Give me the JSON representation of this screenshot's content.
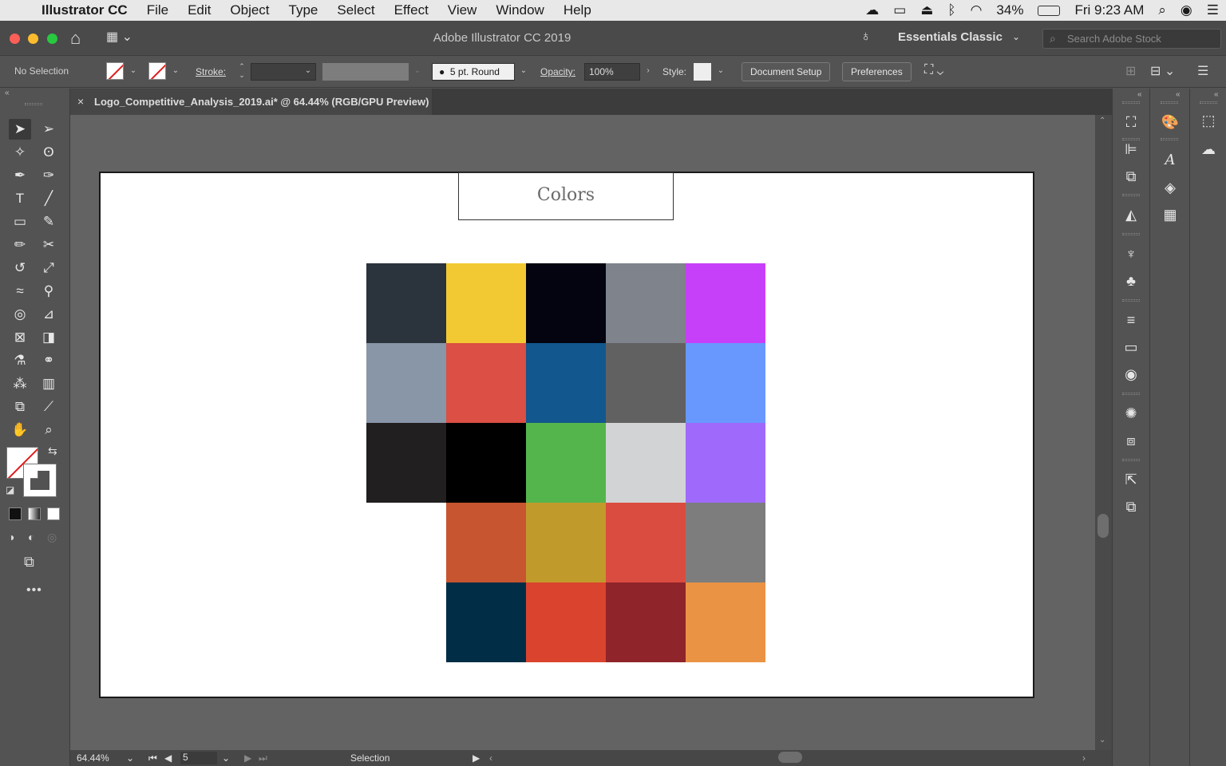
{
  "menubar": {
    "app_name": "Illustrator CC",
    "items": [
      "File",
      "Edit",
      "Object",
      "Type",
      "Select",
      "Effect",
      "View",
      "Window",
      "Help"
    ],
    "battery": "34%",
    "clock": "Fri 9:23 AM"
  },
  "titlebar": {
    "title": "Adobe Illustrator CC 2019",
    "workspace": "Essentials Classic",
    "stock_placeholder": "Search Adobe Stock"
  },
  "controlbar": {
    "selection": "No Selection",
    "stroke_label": "Stroke:",
    "brush": "5 pt. Round",
    "opacity_label": "Opacity:",
    "opacity_value": "100%",
    "style_label": "Style:",
    "document_setup": "Document Setup",
    "preferences": "Preferences"
  },
  "document_tab": {
    "close": "×",
    "title": "Logo_Competitive_Analysis_2019.ai* @ 64.44% (RGB/GPU Preview)"
  },
  "artboard": {
    "heading": "Colors",
    "swatches": [
      [
        "#2b333c",
        "#f2c932",
        "#03040f",
        "#7f838c",
        "#c740f9"
      ],
      [
        "#8896a8",
        "#db4f44",
        "#12578e",
        "#616161",
        "#6898fe"
      ],
      [
        "#221f20",
        "#000000",
        "#54b54c",
        "#d2d3d4",
        "#9f6afb"
      ],
      [
        null,
        "#c7552f",
        "#c19a2c",
        "#db4c40",
        "#7d7d7d"
      ],
      [
        null,
        "#022d47",
        "#da432d",
        "#8f242a",
        "#eb9345"
      ]
    ]
  },
  "statusbar": {
    "zoom": "64.44%",
    "artboard_number": "5",
    "tool": "Selection"
  },
  "icons": {
    "tools": [
      "selection-tool-icon",
      "direct-selection-tool-icon",
      "magic-wand-tool-icon",
      "lasso-tool-icon",
      "pen-tool-icon",
      "curvature-tool-icon",
      "type-tool-icon",
      "line-tool-icon",
      "rectangle-tool-icon",
      "paintbrush-tool-icon",
      "pencil-tool-icon",
      "scissors-tool-icon",
      "rotate-tool-icon",
      "scale-tool-icon",
      "warp-tool-icon",
      "pin-tool-icon",
      "shape-builder-tool-icon",
      "perspective-grid-tool-icon",
      "mesh-tool-icon",
      "gradient-tool-icon",
      "eyedropper-tool-icon",
      "blend-tool-icon",
      "symbol-sprayer-tool-icon",
      "column-graph-tool-icon",
      "artboard-tool-icon",
      "slice-tool-icon",
      "hand-tool-icon",
      "zoom-tool-icon"
    ]
  }
}
